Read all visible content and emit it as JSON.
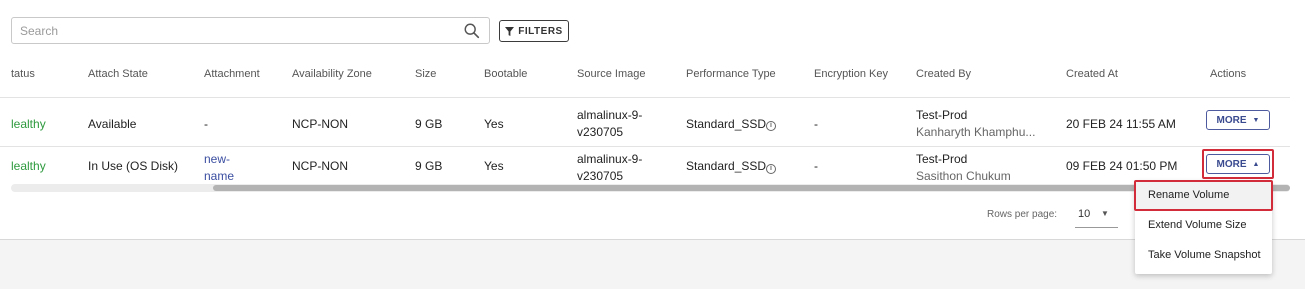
{
  "search": {
    "placeholder": "Search"
  },
  "filters": {
    "label": "FILTERS"
  },
  "columns": [
    "tatus",
    "Attach State",
    "Attachment",
    "Availability Zone",
    "Size",
    "Bootable",
    "Source Image",
    "Performance Type",
    "Encryption Key",
    "Created By",
    "Created At",
    "Actions"
  ],
  "rows": [
    {
      "status": "lealthy",
      "attach_state": "Available",
      "attachment": "-",
      "zone": "NCP-NON",
      "size": "9 GB",
      "bootable": "Yes",
      "source_image_1": "almalinux-9-",
      "source_image_2": "v230705",
      "performance_type": "Standard_SSD",
      "encryption_key": "-",
      "created_by_1": "Test-Prod",
      "created_by_2": "Kanharyth Khamphu...",
      "created_at": "20 FEB 24 11:55 AM",
      "action": "MORE"
    },
    {
      "status": "lealthy",
      "attach_state": "In Use (OS Disk)",
      "attachment_1": "new-",
      "attachment_2": "name",
      "zone": "NCP-NON",
      "size": "9 GB",
      "bootable": "Yes",
      "source_image_1": "almalinux-9-",
      "source_image_2": "v230705",
      "performance_type": "Standard_SSD",
      "encryption_key": "-",
      "created_by_1": "Test-Prod",
      "created_by_2": "Sasithon Chukum",
      "created_at": "09 FEB 24 01:50 PM",
      "action": "MORE"
    }
  ],
  "pagination": {
    "rows_per_page_label": "Rows per page:",
    "rows_per_page_value": "10"
  },
  "menu": {
    "items": [
      "Rename Volume",
      "Extend Volume Size",
      "Take Volume Snapshot"
    ]
  },
  "colors": {
    "healthy": "#2e9a3e",
    "link": "#3b4ea0",
    "primary": "#3a4a8f",
    "highlight": "#d22c3a"
  }
}
